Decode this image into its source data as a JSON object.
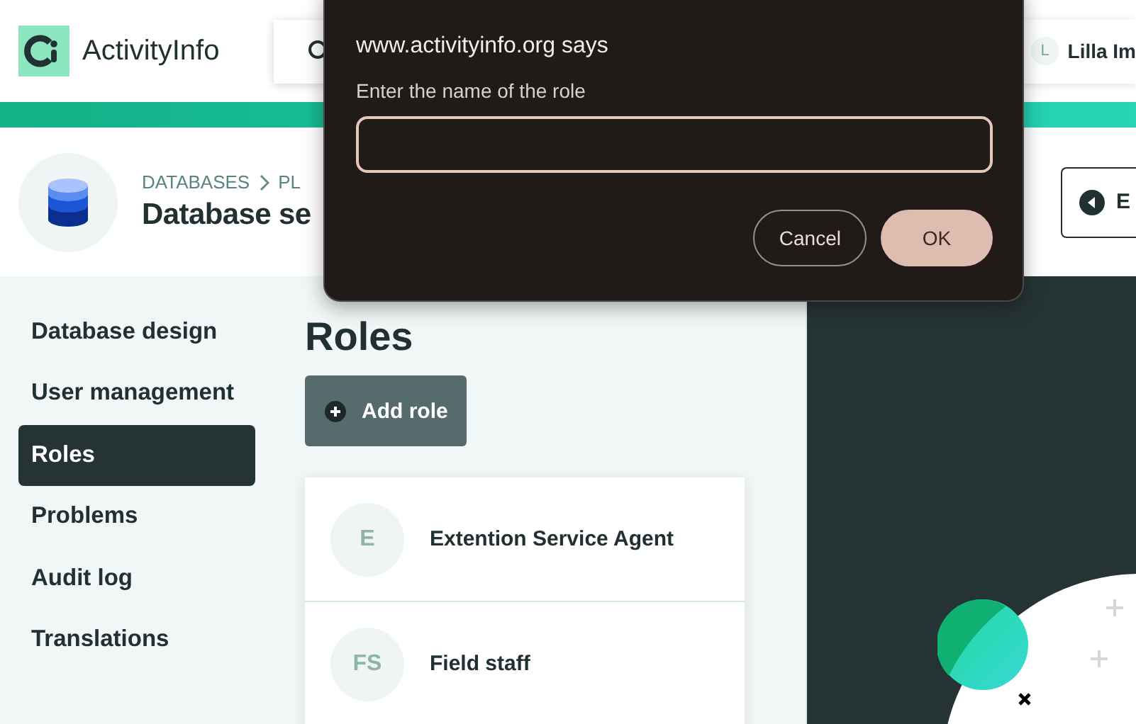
{
  "app": {
    "name": "ActivityInfo"
  },
  "user": {
    "initial": "L",
    "name": "Lilla Im"
  },
  "page": {
    "breadcrumb": [
      "DATABASES",
      "PL"
    ],
    "title": "Database se",
    "back_button": "E"
  },
  "sidebar": {
    "items": [
      {
        "label": "Database design",
        "selected": false
      },
      {
        "label": "User management",
        "selected": false
      },
      {
        "label": "Roles",
        "selected": true
      },
      {
        "label": "Problems",
        "selected": false
      },
      {
        "label": "Audit log",
        "selected": false
      },
      {
        "label": "Translations",
        "selected": false
      }
    ]
  },
  "roles": {
    "title": "Roles",
    "add_button": "Add role",
    "items": [
      {
        "initials": "E",
        "name": "Extention Service Agent"
      },
      {
        "initials": "FS",
        "name": "Field staff"
      }
    ]
  },
  "dialog": {
    "title": "www.activityinfo.org says",
    "prompt": "Enter the name of the role",
    "buttons": [
      {
        "label": "Cancel",
        "kind": "secondary"
      },
      {
        "label": "OK",
        "kind": "primary"
      }
    ]
  }
}
